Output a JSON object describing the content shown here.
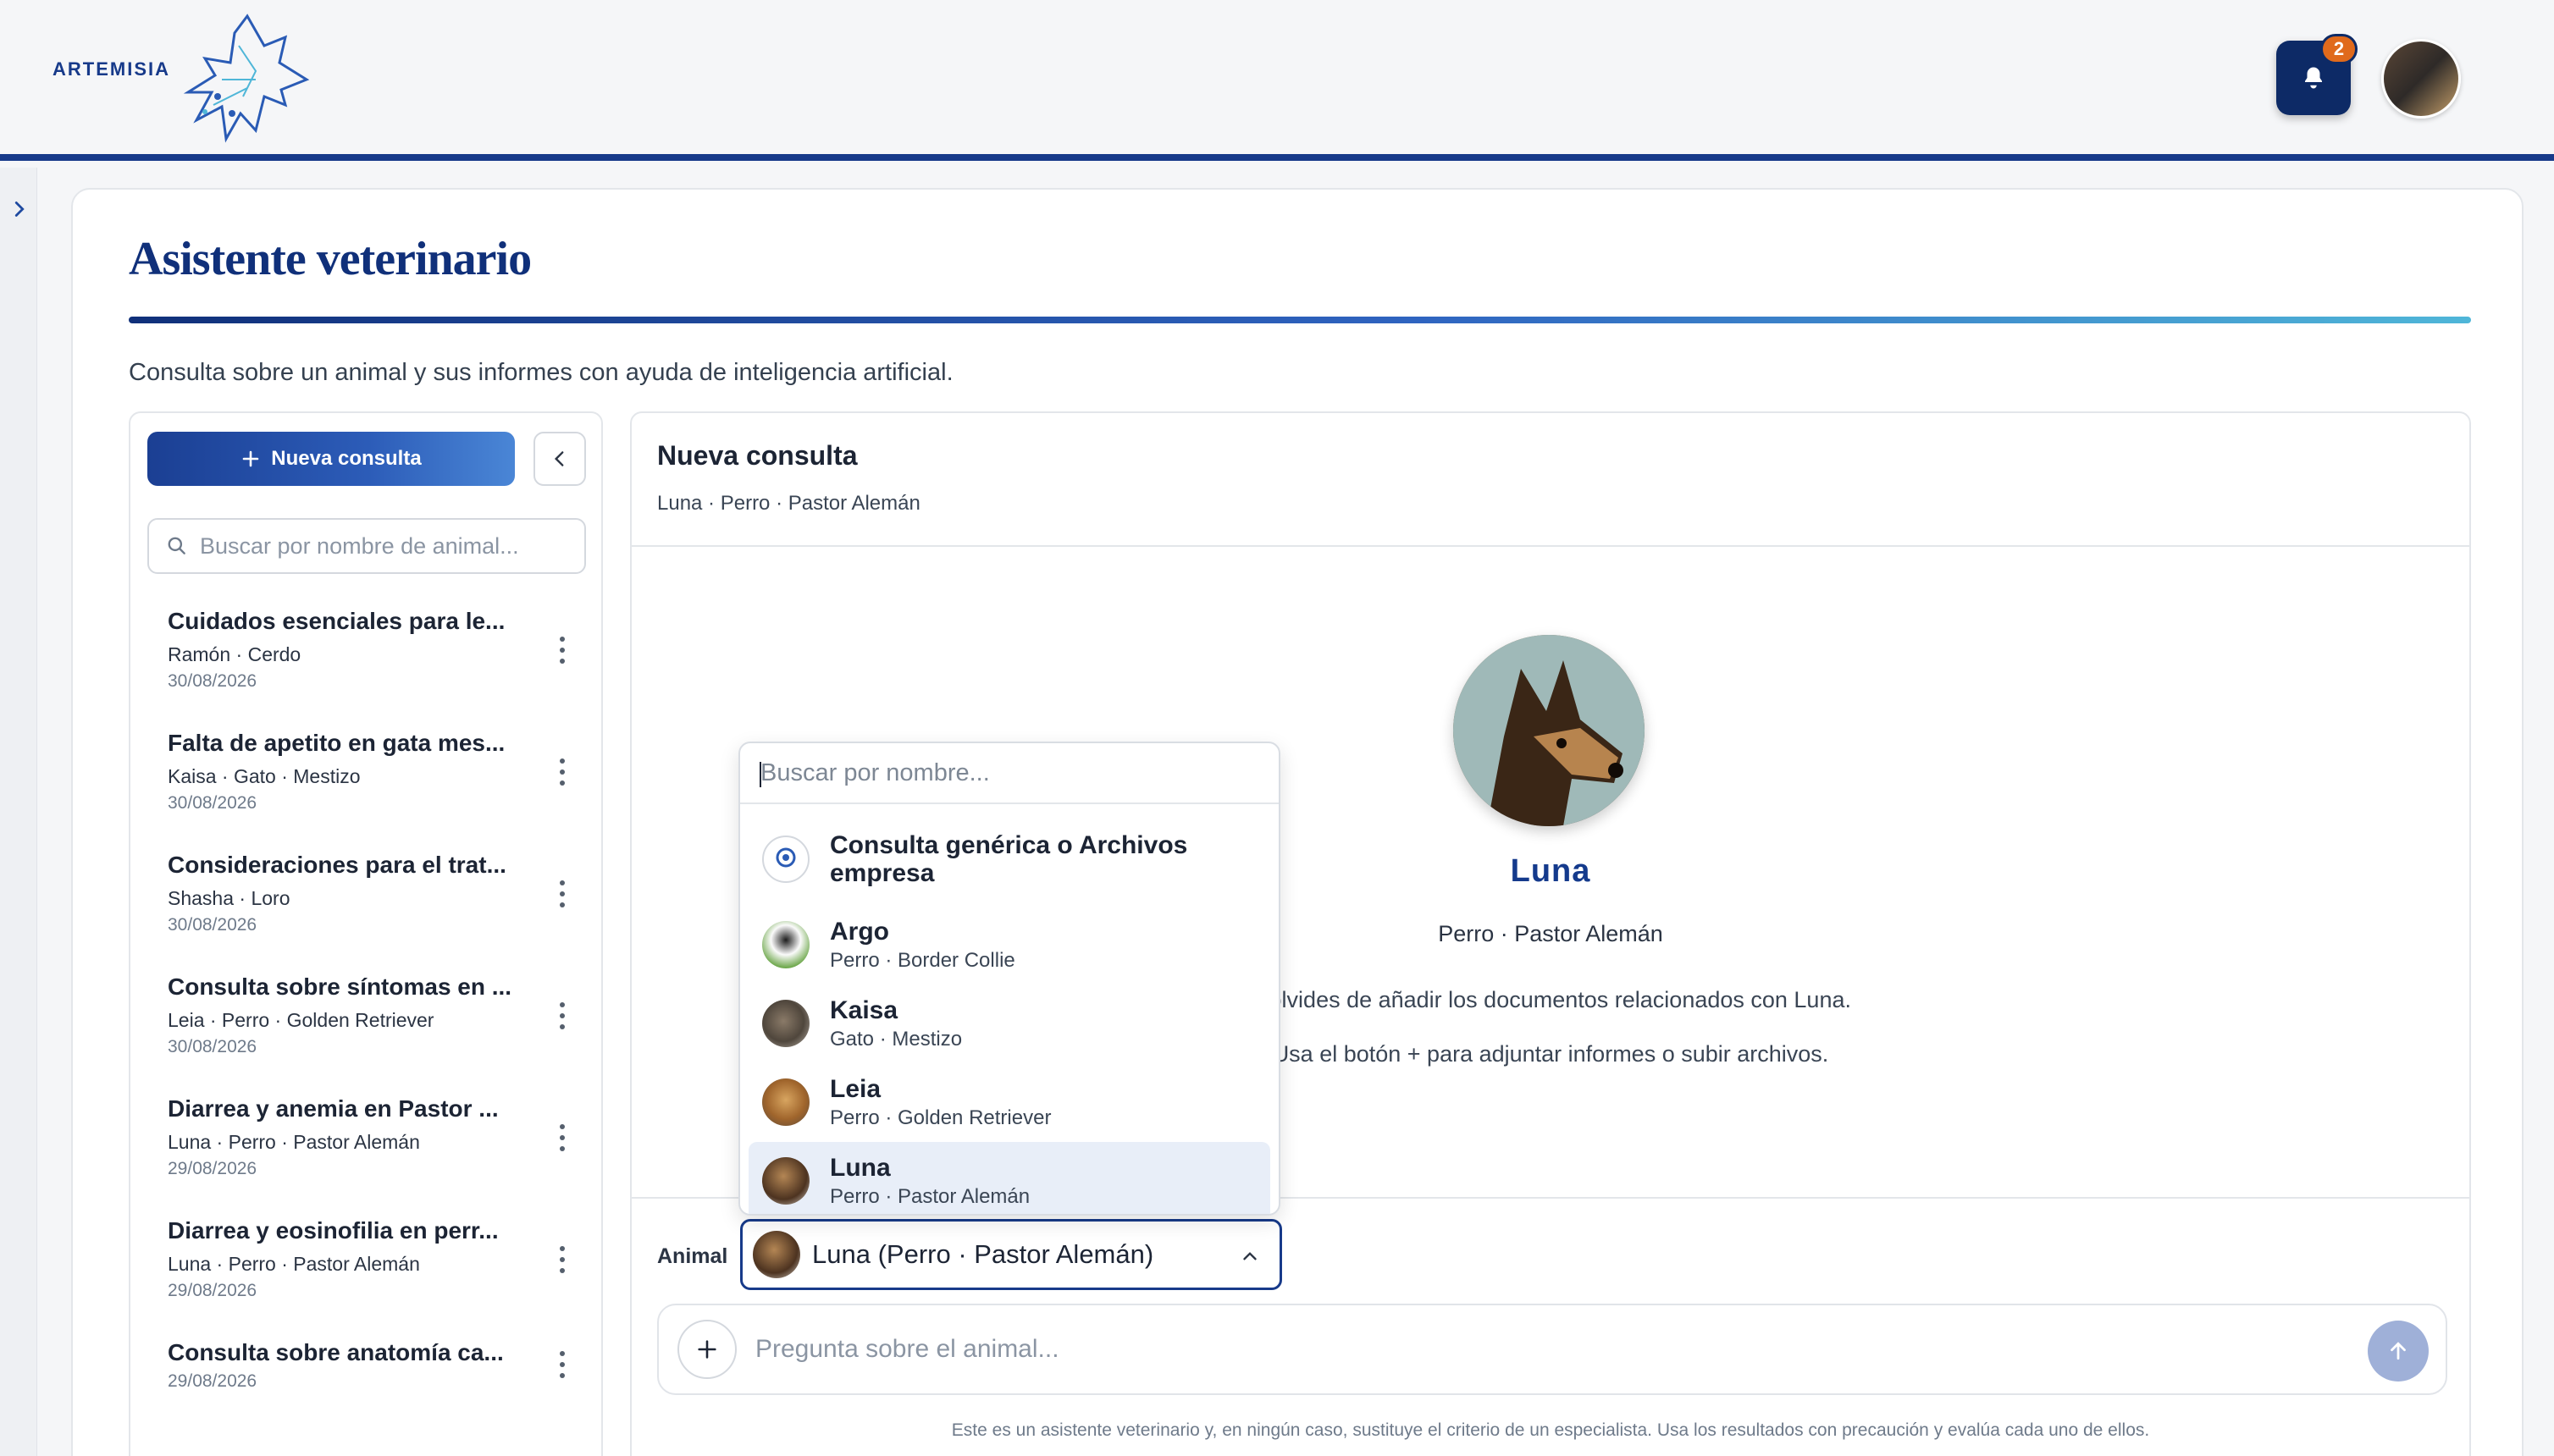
{
  "header": {
    "logo_text": "ARTEMISIA",
    "notifications_count": "2"
  },
  "page": {
    "title": "Asistente veterinario",
    "description": "Consulta sobre un animal y sus informes con ayuda de inteligencia artificial."
  },
  "sidebar": {
    "new_button_label": "Nueva consulta",
    "search_placeholder": "Buscar por nombre de animal...",
    "conversations": [
      {
        "title": "Cuidados esenciales para le...",
        "meta": "Ramón · Cerdo",
        "date": "30/08/2026"
      },
      {
        "title": "Falta de apetito en gata mes...",
        "meta": "Kaisa · Gato · Mestizo",
        "date": "30/08/2026"
      },
      {
        "title": "Consideraciones para el trat...",
        "meta": "Shasha · Loro",
        "date": "30/08/2026"
      },
      {
        "title": "Consulta sobre síntomas en ...",
        "meta": "Leia · Perro · Golden Retriever",
        "date": "30/08/2026"
      },
      {
        "title": "Diarrea y anemia en Pastor ...",
        "meta": "Luna · Perro · Pastor Alemán",
        "date": "29/08/2026"
      },
      {
        "title": "Diarrea y eosinofilia en perr...",
        "meta": "Luna · Perro · Pastor Alemán",
        "date": "29/08/2026"
      },
      {
        "title": "Consulta sobre anatomía ca...",
        "meta": "",
        "date": "29/08/2026"
      }
    ]
  },
  "chat": {
    "title": "Nueva consulta",
    "subtitle": "Luna · Perro · Pastor Alemán",
    "animal_name": "Luna",
    "animal_breed": "Perro · Pastor Alemán",
    "hint_line1": "e olvides de añadir los documentos relacionados con Luna.",
    "hint_line2": "Usa el botón + para adjuntar informes o subir archivos.",
    "animal_label": "Animal",
    "animal_selected": "Luna (Perro · Pastor Alemán)",
    "input_placeholder": "Pregunta sobre el animal...",
    "disclaimer": "Este es un asistente veterinario y, en ningún caso, sustituye el criterio de un especialista. Usa los resultados con precaución y evalúa cada uno de ellos."
  },
  "dropdown": {
    "search_placeholder": "Buscar por nombre...",
    "options": [
      {
        "name": "Consulta genérica o Archivos empresa",
        "meta": ""
      },
      {
        "name": "Argo",
        "meta": "Perro · Border Collie"
      },
      {
        "name": "Kaisa",
        "meta": "Gato · Mestizo"
      },
      {
        "name": "Leia",
        "meta": "Perro · Golden Retriever"
      },
      {
        "name": "Luna",
        "meta": "Perro · Pastor Alemán"
      }
    ]
  },
  "colors": {
    "brand_dark": "#173a8a",
    "accent_orange": "#e06a1c",
    "selected_row": "#e8eef8"
  }
}
